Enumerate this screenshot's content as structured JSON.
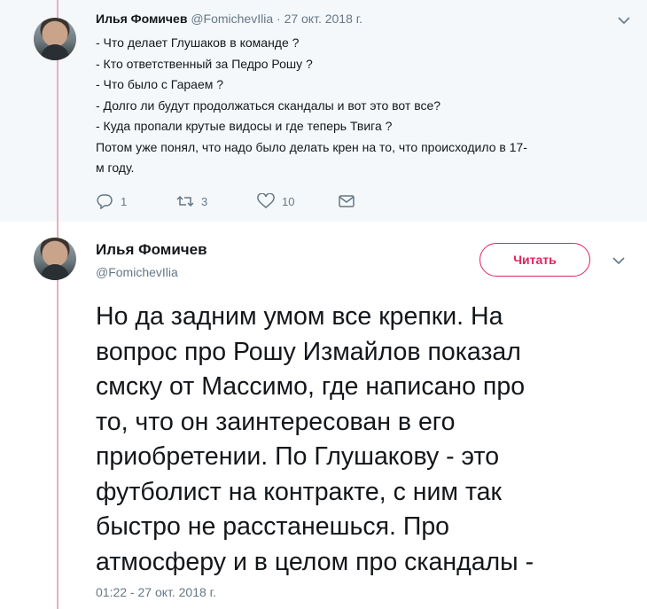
{
  "parent_tweet": {
    "author_name": "Илья Фомичев",
    "author_handle": "@FomichevIlia",
    "separator": "·",
    "date": "27 окт. 2018 г.",
    "lines": [
      "- Что делает Глушаков в команде ?",
      "- Кто ответственный за Педро Рошу ?",
      "- Что было с Гараем ?",
      "- Долго ли будут продолжаться скандалы и вот это вот все?",
      "- Куда пропали крутые видосы и где теперь Твига ?",
      "Потом уже понял, что надо было делать крен на то, что происходило в 17-",
      "м году."
    ],
    "actions": {
      "reply_count": "1",
      "retweet_count": "3",
      "like_count": "10"
    }
  },
  "main_tweet": {
    "author_name": "Илья Фомичев",
    "author_handle": "@FomichevIlia",
    "follow_label": "Читать",
    "lines": [
      "Но да задним умом все крепки. На",
      "вопрос про Рошу Измайлов показал",
      "смску от Массимо, где написано про",
      "то, что он заинтересован в его",
      "приобретении. По Глушакову - это",
      "футболист на контракте, с ним так",
      "быстро не расстанешься. Про",
      "атмосферу и в целом про скандалы -"
    ],
    "timestamp": "01:22 - 27 окт. 2018 г."
  },
  "colors": {
    "accent": "#e0245e",
    "secondary_text": "#657786",
    "thread_line": "#e6b0bd",
    "parent_background": "#f5f8fa"
  },
  "icons": [
    "reply-icon",
    "retweet-icon",
    "like-icon",
    "direct-message-icon",
    "chevron-down-icon"
  ]
}
